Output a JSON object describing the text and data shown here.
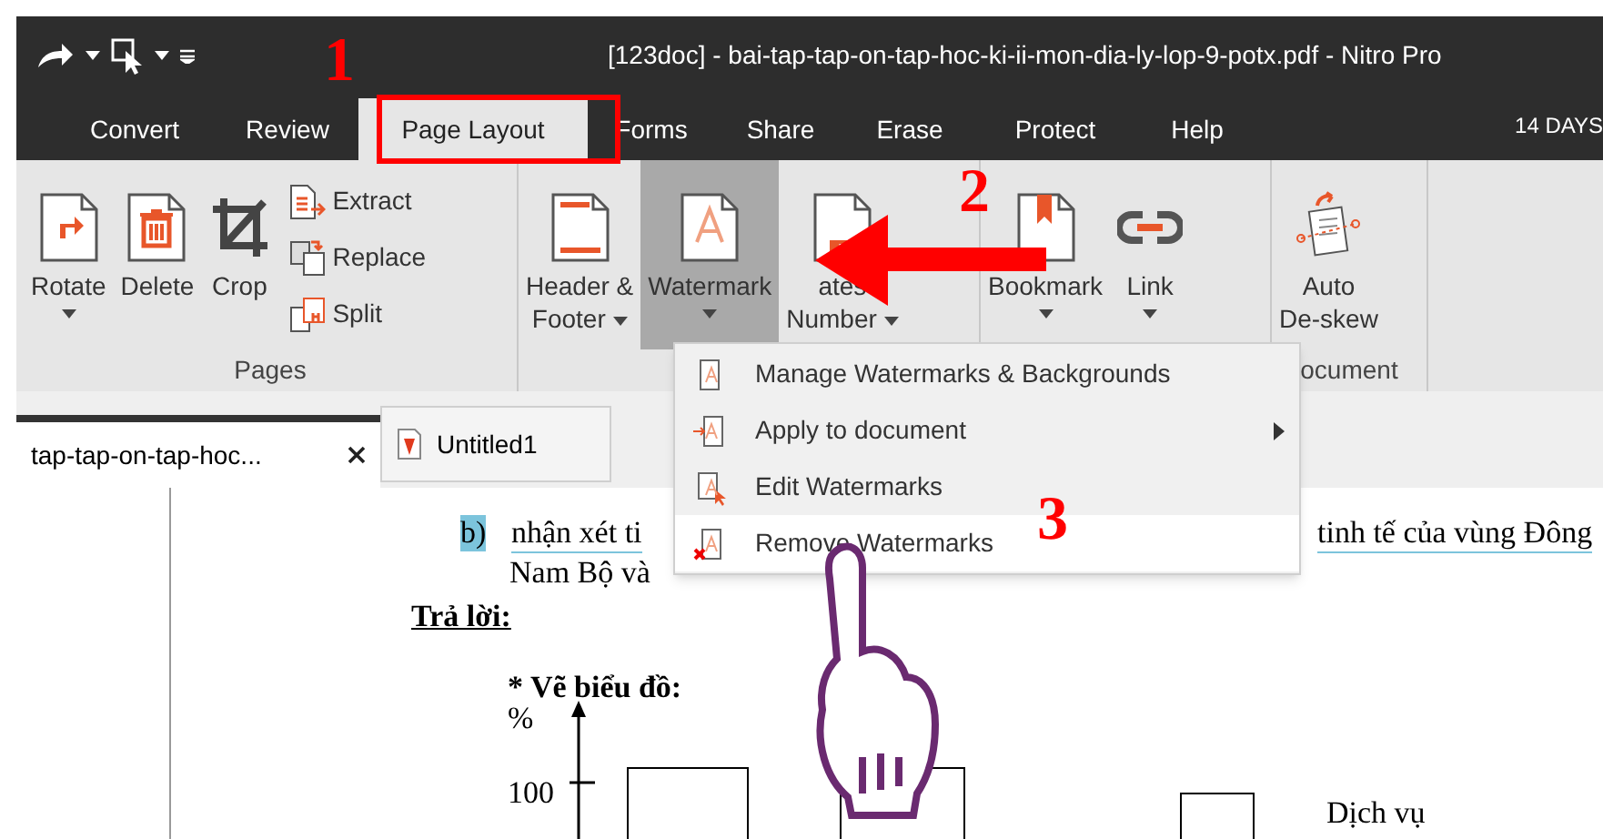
{
  "window": {
    "title": "[123doc] - bai-tap-tap-on-tap-hoc-ki-ii-mon-dia-ly-lop-9-potx.pdf - Nitro Pro",
    "trial": "14 DAYS"
  },
  "menu_tabs": [
    {
      "label": "Convert",
      "selected": false
    },
    {
      "label": "Review",
      "selected": false
    },
    {
      "label": "Page Layout",
      "selected": true
    },
    {
      "label": "Forms",
      "selected": false
    },
    {
      "label": "Share",
      "selected": false
    },
    {
      "label": "Erase",
      "selected": false
    },
    {
      "label": "Protect",
      "selected": false
    },
    {
      "label": "Help",
      "selected": false
    }
  ],
  "ribbon": {
    "groups": [
      {
        "label": "Pages",
        "buttons": [
          {
            "kind": "large",
            "lines": [
              "Rotate"
            ],
            "dropdown": true,
            "selected": false
          },
          {
            "kind": "large",
            "lines": [
              "Delete"
            ],
            "dropdown": false,
            "selected": false
          },
          {
            "kind": "large",
            "lines": [
              "Crop"
            ],
            "dropdown": false,
            "selected": false
          },
          {
            "kind": "small",
            "lines": [
              "Extract"
            ],
            "dropdown": false,
            "selected": false
          },
          {
            "kind": "small",
            "lines": [
              "Replace"
            ],
            "dropdown": false,
            "selected": false
          },
          {
            "kind": "small",
            "lines": [
              "Split"
            ],
            "dropdown": false,
            "selected": false
          }
        ]
      },
      {
        "buttons": [
          {
            "kind": "large",
            "lines": [
              "Header &",
              "Footer"
            ],
            "dropdown": true,
            "selected": false
          },
          {
            "kind": "large",
            "lines": [
              "Watermark"
            ],
            "dropdown": true,
            "selected": true
          },
          {
            "kind": "large",
            "lines": [
              "ates",
              "Number"
            ],
            "dropdown": true,
            "selected": false
          }
        ]
      },
      {
        "buttons": [
          {
            "kind": "large",
            "lines": [
              "Bookmark"
            ],
            "dropdown": true,
            "selected": false
          },
          {
            "kind": "large",
            "lines": [
              "Link"
            ],
            "dropdown": true,
            "selected": false
          }
        ]
      },
      {
        "label": "ocument",
        "buttons": [
          {
            "kind": "large",
            "lines": [
              "Auto",
              "De-skew"
            ],
            "dropdown": false,
            "selected": false
          }
        ]
      }
    ]
  },
  "dropdown_menu": {
    "items": [
      {
        "label": "Manage Watermarks & Backgrounds",
        "submenu": false,
        "selected": false
      },
      {
        "label": "Apply to document",
        "submenu": true,
        "selected": false
      },
      {
        "label": "Edit Watermarks",
        "submenu": false,
        "selected": false
      },
      {
        "label": "Remove Watermarks",
        "submenu": false,
        "selected": true
      }
    ]
  },
  "document_tabs": [
    {
      "label": "tap-tap-on-tap-hoc...",
      "selected": true,
      "closable": true
    },
    {
      "label": "Untitled1",
      "selected": false,
      "closable": false
    }
  ],
  "document": {
    "item_label": "b)",
    "line_1_start": "nhận xét ti",
    "line_1_end": "tinh tế của vùng Đông",
    "line_2": "Nam Bộ và",
    "answer_heading": "Trả lời:",
    "chart_heading": "* Vẽ biểu đồ:",
    "chart": {
      "y_unit": "%",
      "y_tick": "100",
      "legend": "Dịch vụ"
    }
  },
  "annotations": {
    "steps": [
      "1",
      "2",
      "3"
    ]
  }
}
